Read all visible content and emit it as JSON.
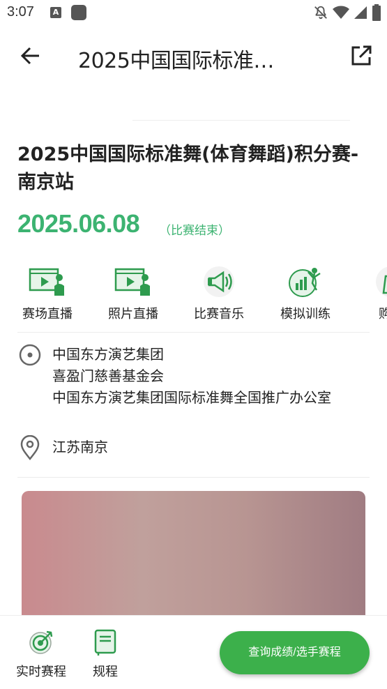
{
  "status_bar": {
    "time": "3:07"
  },
  "header": {
    "title": "2025中国国际标准…"
  },
  "event": {
    "title": "2025中国国际标准舞(体育舞蹈)积分赛-南京站",
    "date": "2025.06.08",
    "status": "（比赛结束）"
  },
  "features": [
    {
      "label": "赛场直播",
      "icon": "live-video-icon"
    },
    {
      "label": "照片直播",
      "icon": "photo-live-icon"
    },
    {
      "label": "比赛音乐",
      "icon": "megaphone-icon"
    },
    {
      "label": "模拟训练",
      "icon": "training-icon"
    },
    {
      "label": "购买",
      "icon": "purchase-icon"
    }
  ],
  "organizers": [
    "中国东方演艺集团",
    "喜盈门慈善基金会",
    "中国东方演艺集团国际标准舞全国推广办公室"
  ],
  "location": "江苏南京",
  "bottom_nav": {
    "schedule_label": "实时赛程",
    "rules_label": "规程",
    "cta_label": "查询成绩/选手赛程"
  },
  "colors": {
    "accent": "#3cb371",
    "button": "#3cb04b",
    "icon_green": "#2e9b4e"
  }
}
